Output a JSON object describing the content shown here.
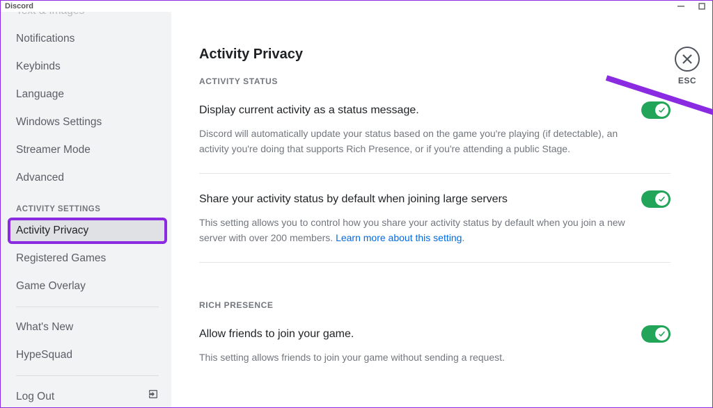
{
  "titlebar": {
    "title": "Discord"
  },
  "sidebar": {
    "items": [
      {
        "label": "Text & Images",
        "type": "item",
        "cutTop": true
      },
      {
        "label": "Notifications",
        "type": "item"
      },
      {
        "label": "Keybinds",
        "type": "item"
      },
      {
        "label": "Language",
        "type": "item"
      },
      {
        "label": "Windows Settings",
        "type": "item"
      },
      {
        "label": "Streamer Mode",
        "type": "item"
      },
      {
        "label": "Advanced",
        "type": "item"
      },
      {
        "label": "ACTIVITY SETTINGS",
        "type": "header"
      },
      {
        "label": "Activity Privacy",
        "type": "item",
        "active": true,
        "highlighted": true
      },
      {
        "label": "Registered Games",
        "type": "item"
      },
      {
        "label": "Game Overlay",
        "type": "item"
      },
      {
        "type": "divider"
      },
      {
        "label": "What's New",
        "type": "item"
      },
      {
        "label": "HypeSquad",
        "type": "item"
      },
      {
        "type": "divider"
      },
      {
        "label": "Log Out",
        "type": "item",
        "icon": "logout"
      }
    ]
  },
  "page": {
    "title": "Activity Privacy",
    "closeLabel": "ESC",
    "sections": [
      {
        "header": "ACTIVITY STATUS",
        "settings": [
          {
            "title": "Display current activity as a status message.",
            "desc": "Discord will automatically update your status based on the game you're playing (if detectable), an activity you're doing that supports Rich Presence, or if you're attending a public Stage.",
            "toggle": true
          },
          {
            "title": "Share your activity status by default when joining large servers",
            "desc": "This setting allows you to control how you share your activity status by default when you join a new server with over 200 members. ",
            "link": "Learn more about this setting",
            "linkSuffix": ".",
            "toggle": true
          }
        ]
      },
      {
        "header": "RICH PRESENCE",
        "settings": [
          {
            "title": "Allow friends to join your game.",
            "desc": "This setting allows friends to join your game without sending a request.",
            "toggle": true
          }
        ]
      }
    ]
  },
  "annotation": {
    "color": "#8a2be2"
  }
}
